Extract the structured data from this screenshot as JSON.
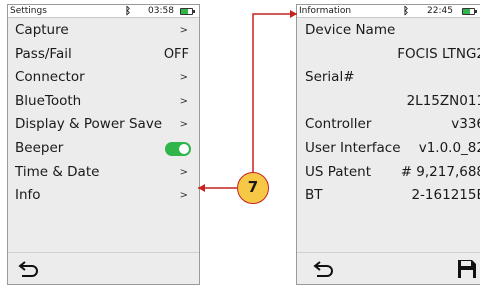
{
  "left_screen": {
    "status": {
      "title": "Settings",
      "bt_icon": "bluetooth-icon",
      "time": "03:58",
      "battery_level": 0.6
    },
    "menu": [
      {
        "label": "Capture",
        "value": "",
        "kind": "chevron"
      },
      {
        "label": "Pass/Fail",
        "value": "OFF",
        "kind": "value"
      },
      {
        "label": "Connector",
        "value": "",
        "kind": "chevron"
      },
      {
        "label": "BlueTooth",
        "value": "",
        "kind": "chevron"
      },
      {
        "label": "Display & Power Save",
        "value": "",
        "kind": "chevron"
      },
      {
        "label": "Beeper",
        "value": "",
        "kind": "toggle",
        "on": true
      },
      {
        "label": "Time & Date",
        "value": "",
        "kind": "chevron"
      },
      {
        "label": "Info",
        "value": "",
        "kind": "chevron"
      }
    ],
    "chevron_glyph": ">",
    "back_icon": "back-arrow-icon"
  },
  "right_screen": {
    "status": {
      "title": "Information",
      "bt_icon": "bluetooth-icon",
      "time": "22:45",
      "battery_level": 0.6
    },
    "rows": [
      {
        "label": "Device Name",
        "value": ""
      },
      {
        "label": "",
        "value": "FOCIS LTNG2"
      },
      {
        "label": "Serial#",
        "value": ""
      },
      {
        "label": "",
        "value": "2L15ZN011"
      },
      {
        "label": "Controller",
        "value": "v336"
      },
      {
        "label": "User Interface",
        "value": "v1.0.0_82"
      },
      {
        "label": "US Patent",
        "value": "# 9,217,688"
      },
      {
        "label": "BT",
        "value": "2-161215E"
      }
    ],
    "back_icon": "back-arrow-icon",
    "save_icon": "save-icon"
  },
  "callout": {
    "number": "7",
    "color": "#c62222",
    "fill": "#f7c845"
  },
  "colors": {
    "accent_green": "#2fb54a",
    "screen_bg": "#ececec"
  }
}
